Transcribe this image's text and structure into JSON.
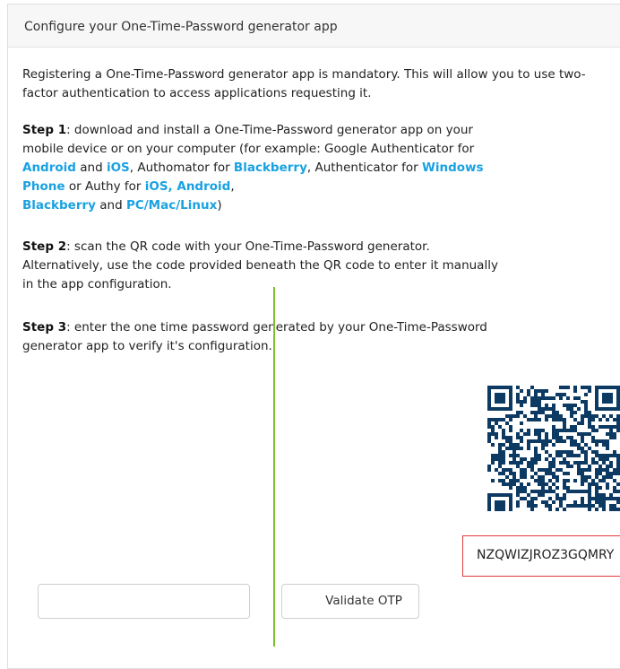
{
  "header": {
    "title": "Configure your One-Time-Password generator app"
  },
  "intro": {
    "text": "Registering a One-Time-Password generator app is mandatory. This will allow you to use two-factor authentication to access applications requesting it."
  },
  "step1": {
    "label": "Step 1",
    "text1": ": download and install a One-Time-Password generator app on your mobile device or on your computer (for example: Google Authenticator for ",
    "link_android": "Android",
    "and1": " and ",
    "link_ios": "iOS",
    "text2": ", Authomator for ",
    "link_blackberry": "Blackberry",
    "text3": ", Authenticator for ",
    "link_windows_phone": "Windows Phone",
    "text4": " or Authy for ",
    "link_ios_android": "iOS, Android",
    "comma": ",",
    "link_blackberry2": "Blackberry",
    "and2": " and ",
    "link_pc": "PC/Mac/Linux",
    "close": ")"
  },
  "step2": {
    "label": "Step 2",
    "text": ": scan the QR code with your One-Time-Password generator. Alternatively, use the code provided beneath the QR code to enter it manually in the app configuration."
  },
  "step3": {
    "label": "Step 3",
    "text": ": enter the one time password generated by your One-Time-Password generator app to verify it's configuration."
  },
  "secret": {
    "code": "NZQWIZJROZ3GQMRY"
  },
  "otp_form": {
    "input_value": "",
    "input_placeholder": "",
    "validate_label": "Validate OTP"
  },
  "colors": {
    "link": "#1aa1e1",
    "secret_border": "#e23b3b",
    "guide_line": "#7cc12c",
    "qr": "#0d3a63"
  }
}
